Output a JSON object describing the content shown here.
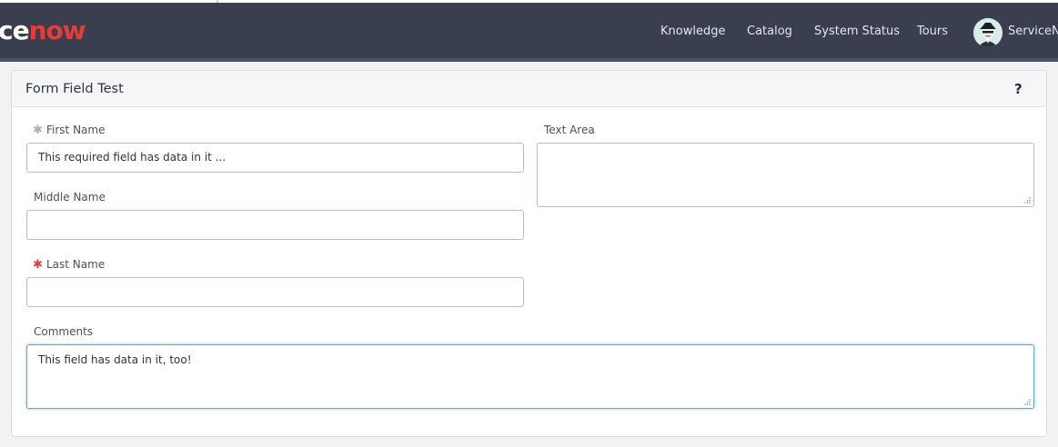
{
  "header": {
    "logo_part1": "ce",
    "logo_part2": "now",
    "nav": [
      "Knowledge",
      "Catalog",
      "System Status",
      "Tours"
    ],
    "user_name": "ServiceNo",
    "avatar_icon": "user-avatar-icon"
  },
  "form": {
    "title": "Form Field Test",
    "help_glyph": "?",
    "required_glyph": "✱",
    "first_name": {
      "label": "First Name",
      "value": "This required field has data in it ..."
    },
    "middle_name": {
      "label": "Middle Name",
      "value": ""
    },
    "last_name": {
      "label": "Last Name",
      "value": ""
    },
    "text_area": {
      "label": "Text Area",
      "value": ""
    },
    "comments": {
      "label": "Comments",
      "value": "This field has data in it, too!"
    }
  },
  "colors": {
    "navbar": "#3a3f4f",
    "brand_red": "#e33c3c",
    "required_red": "#e23c3c",
    "focus_blue": "#5aa9d6"
  }
}
